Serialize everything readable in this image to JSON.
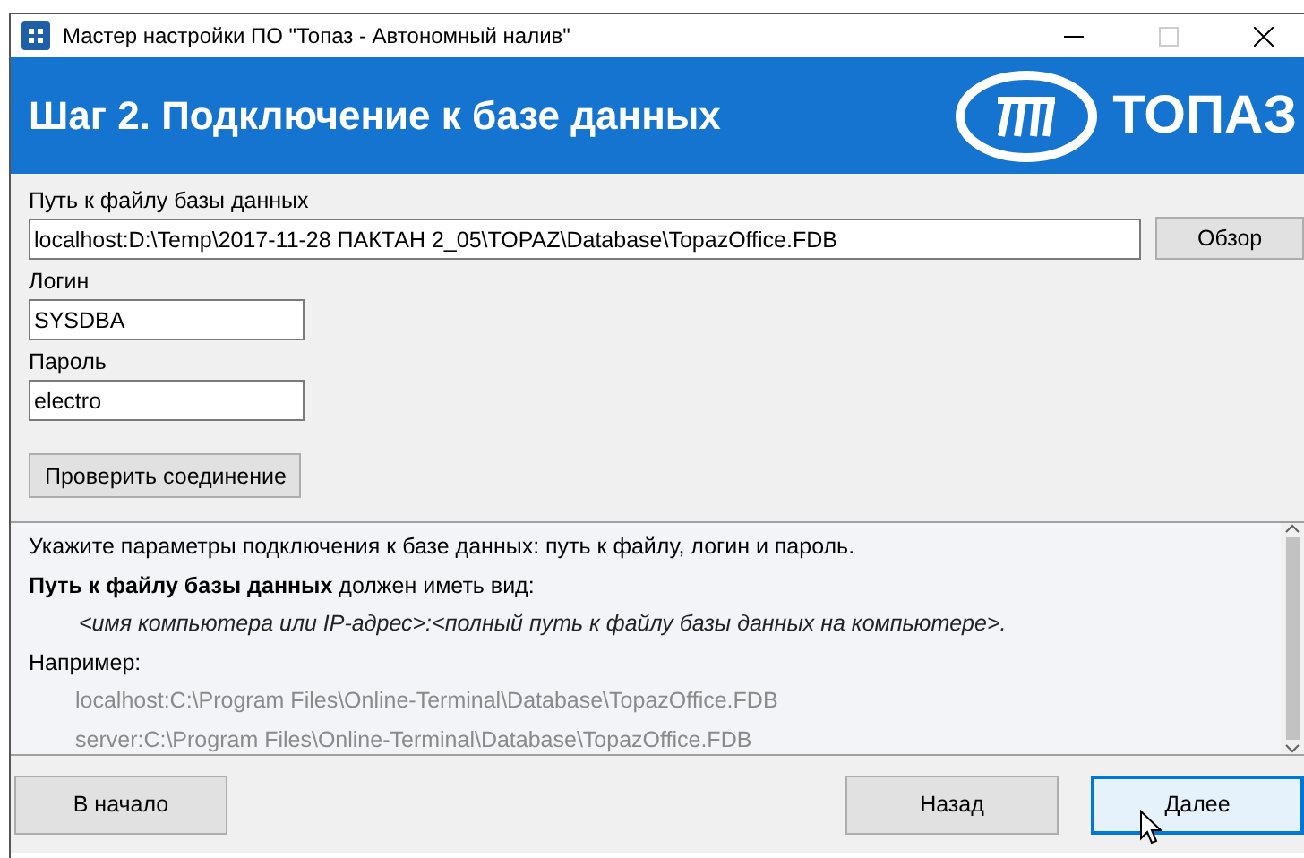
{
  "window": {
    "title": "Мастер настройки ПО \"Топаз - Автономный налив\""
  },
  "header": {
    "title": "Шаг 2. Подключение к базе данных",
    "logo_text": "ТОПАЗ"
  },
  "form": {
    "fields": [
      {
        "label": "Путь к файлу базы данных",
        "value": "localhost:D:\\Temp\\2017-11-28 ПАКТАН 2_05\\TOPAZ\\Database\\TopazOffice.FDB",
        "kind": "path",
        "button": "Обзор"
      },
      {
        "label": "Логин",
        "value": "SYSDBA",
        "kind": "short"
      },
      {
        "label": "Пароль",
        "value": "electro",
        "kind": "short"
      }
    ],
    "check_button": "Проверить соединение"
  },
  "info": {
    "lines": [
      {
        "kind": "plain",
        "text": "Укажите параметры подключения к базе данных: путь к файлу, логин и пароль."
      },
      {
        "kind": "plain",
        "text": "**Путь к файлу базы данных** должен иметь вид:"
      },
      {
        "kind": "format",
        "text": "<имя компьютера или IP-адрес>:<полный путь к файлу базы данных на компьютере>."
      },
      {
        "kind": "plain",
        "text": "Например:"
      },
      {
        "kind": "example",
        "text": "localhost:C:\\Program Files\\Online-Terminal\\Database\\TopazOffice.FDB"
      },
      {
        "kind": "example",
        "text": "server:C:\\Program Files\\Online-Terminal\\Database\\TopazOffice.FDB"
      }
    ]
  },
  "footer": {
    "buttons": [
      {
        "label": "В начало",
        "focused": false
      },
      {
        "label": "Назад",
        "focused": false
      },
      {
        "label": "Далее",
        "focused": true
      }
    ]
  }
}
